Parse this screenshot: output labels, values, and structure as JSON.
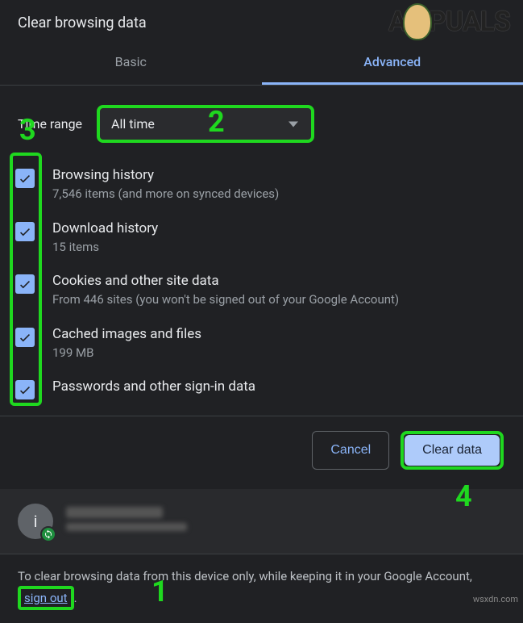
{
  "dialog": {
    "title": "Clear browsing data"
  },
  "tabs": {
    "basic": "Basic",
    "advanced": "Advanced"
  },
  "range": {
    "label": "Time range",
    "value": "All time"
  },
  "options": [
    {
      "title": "Browsing history",
      "sub": "7,546 items (and more on synced devices)"
    },
    {
      "title": "Download history",
      "sub": "15 items"
    },
    {
      "title": "Cookies and other site data",
      "sub": "From 446 sites (you won't be signed out of your Google Account)"
    },
    {
      "title": "Cached images and files",
      "sub": "199 MB"
    },
    {
      "title": "Passwords and other sign-in data",
      "sub": ""
    }
  ],
  "actions": {
    "cancel": "Cancel",
    "clear": "Clear data"
  },
  "account": {
    "initial": "i"
  },
  "footer": {
    "pre": "To clear browsing data from this device only, while keeping it in your Google Account, ",
    "link": "sign out",
    "post": "."
  },
  "annotations": {
    "n1": "1",
    "n2": "2",
    "n3": "3",
    "n4": "4"
  },
  "watermark": "wsxdn.com",
  "logo": {
    "left": "A",
    "right": "PUALS"
  }
}
